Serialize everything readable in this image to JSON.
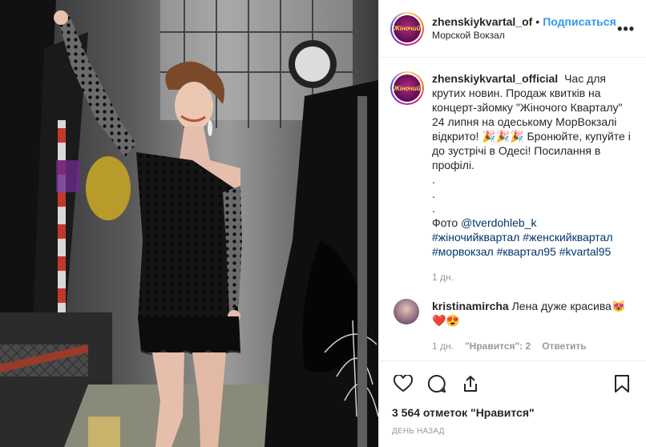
{
  "post": {
    "username": "zhenskiykvartal_of",
    "separator": "•",
    "follow_label": "Подписаться",
    "location": "Морской Вокзал",
    "more_icon": "more-icon",
    "avatar_text": "Жіночий"
  },
  "caption": {
    "username": "zhenskiykvartal_official",
    "text_part1": "Час для крутих новин. Продаж квитків на концерт-зйомку \"Жіночого Кварталу\" 24 липня на одеському МорВокзалі відкрито! 🎉🎉🎉 Бронюйте, купуйте і до зустрічі в Одесі! Посилання в профілі.",
    "dots": [
      ".",
      ".",
      "."
    ],
    "photo_prefix": "Фото",
    "mention": "@tverdohleb_k",
    "hashtags": [
      "#жіночийквартал",
      "#женскийквартал",
      "#морвокзал",
      "#квартал95",
      "#kvartal95"
    ],
    "age": "1 дн."
  },
  "comment": {
    "username": "kristinamircha",
    "text": "Лена дуже красива😻 ❤️😍",
    "age": "1 дн.",
    "likes": "\"Нравится\": 2",
    "reply": "Ответить"
  },
  "actions": {
    "like_icon": "heart-icon",
    "comment_icon": "comment-icon",
    "share_icon": "share-icon",
    "save_icon": "bookmark-icon",
    "likes_text": "3 564 отметок \"Нравится\"",
    "timestamp": "День назад"
  },
  "colors": {
    "link": "#3897f0",
    "tag": "#003569",
    "muted": "#999999",
    "border": "#efefef"
  }
}
